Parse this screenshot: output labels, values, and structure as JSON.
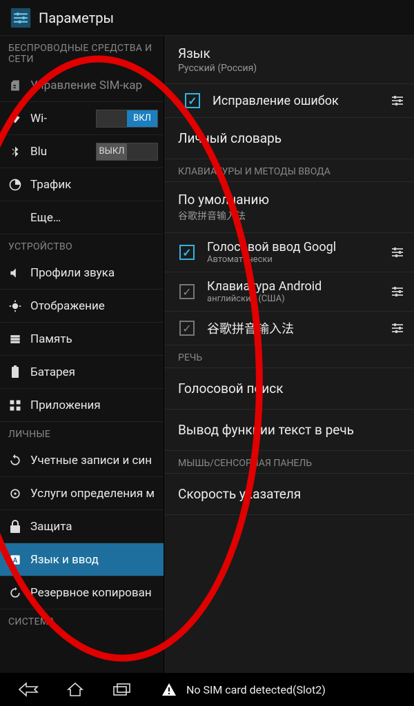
{
  "appbar": {
    "title": "Параметры"
  },
  "left": {
    "sections": [
      {
        "header": "БЕСПРОВОДНЫЕ СРЕДСТВА И СЕТИ",
        "items": [
          {
            "id": "sim",
            "icon": "sim-icon",
            "label": "Управление SIM-кар",
            "faded": true
          },
          {
            "id": "wifi",
            "icon": "wifi-icon",
            "label": "Wi-",
            "toggle": "on",
            "toggle_label": "ВКЛ"
          },
          {
            "id": "bt",
            "icon": "bt-icon",
            "label": "Blu",
            "toggle": "off",
            "toggle_label": "ВЫКЛ"
          },
          {
            "id": "data",
            "icon": "data-icon",
            "label": "Трафик"
          },
          {
            "id": "more",
            "icon": "",
            "label": "Еще…"
          }
        ]
      },
      {
        "header": "УСТРОЙСТВО",
        "items": [
          {
            "id": "audio",
            "icon": "audio-icon",
            "label": "Профили звука"
          },
          {
            "id": "display",
            "icon": "display-icon",
            "label": "Отображение"
          },
          {
            "id": "storage",
            "icon": "storage-icon",
            "label": "Память"
          },
          {
            "id": "battery",
            "icon": "battery-icon",
            "label": "Батарея"
          },
          {
            "id": "apps",
            "icon": "apps-icon",
            "label": "Приложения"
          }
        ]
      },
      {
        "header": "ЛИЧНЫЕ",
        "items": [
          {
            "id": "accounts",
            "icon": "sync-icon",
            "label": "Учетные записи и син"
          },
          {
            "id": "location",
            "icon": "location-icon",
            "label": "Услуги определения м"
          },
          {
            "id": "security",
            "icon": "lock-icon",
            "label": "Защита"
          },
          {
            "id": "lang",
            "icon": "lang-icon",
            "label": "Язык и ввод",
            "selected": true
          },
          {
            "id": "backup",
            "icon": "backup-icon",
            "label": "Резервное копирован"
          }
        ]
      },
      {
        "header": "СИСТЕМА",
        "items": []
      }
    ]
  },
  "right": {
    "language": {
      "title": "Язык",
      "value": "Русский (Россия)"
    },
    "spellcheck": {
      "label": "Исправление ошибок",
      "checked": true
    },
    "personal_dict": "Личный словарь",
    "kbd_section": "КЛАВИАТУРЫ И МЕТОДЫ ВВОДА",
    "default": {
      "title": "По умолчанию",
      "sub": "谷歌拼音输入法"
    },
    "imes": [
      {
        "title": "Голосовой ввод Googl",
        "sub": "Автоматически",
        "checked": "blue"
      },
      {
        "title": "Клавиатура Android",
        "sub": "английский (США)",
        "checked": "dim"
      },
      {
        "title": "谷歌拼音输入法",
        "sub": "",
        "checked": "dim"
      }
    ],
    "speech_section": "РЕЧЬ",
    "voice_search": "Голосовой поиск",
    "tts": "Вывод функции текст в речь",
    "mouse_section": "МЫШЬ/СЕНСОРНАЯ ПАНЕЛЬ",
    "pointer": "Скорость указателя"
  },
  "navbar": {
    "alert": "No SIM card detected(Slot2)"
  }
}
